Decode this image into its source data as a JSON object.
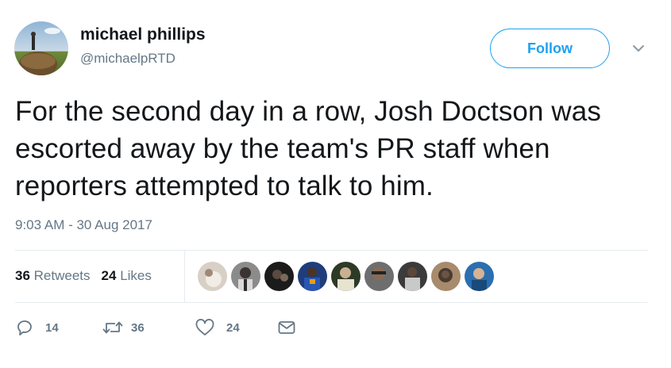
{
  "user": {
    "name": "michael phillips",
    "handle": "@michaelpRTD"
  },
  "follow_label": "Follow",
  "tweet": {
    "text": "For the second day in a row, Josh Doctson was escorted away by the team's PR staff when reporters attempted to talk to him.",
    "timestamp": "9:03 AM - 30 Aug 2017"
  },
  "stats": {
    "retweets_count": "36",
    "retweets_label": "Retweets",
    "likes_count": "24",
    "likes_label": "Likes"
  },
  "actions": {
    "reply_count": "14",
    "retweet_count": "36",
    "like_count": "24"
  },
  "colors": {
    "accent": "#1da1f2",
    "secondary_text": "#657786",
    "divider": "#e6ecf0"
  },
  "icons": [
    "chevron-down-icon",
    "reply-icon",
    "retweet-icon",
    "heart-icon",
    "message-icon"
  ]
}
